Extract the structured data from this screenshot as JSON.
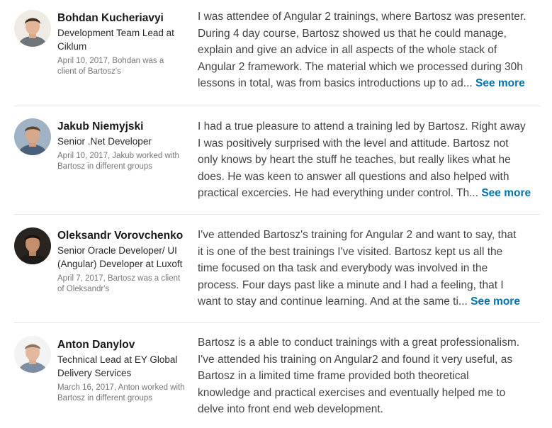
{
  "colors": {
    "link": "#0073b1",
    "divider": "#e6e6e6"
  },
  "recommendations": [
    {
      "name": "Bohdan Kucheriavyi",
      "headline": "Development Team Lead at Ciklum",
      "meta": "April 10, 2017, Bohdan was a client of Bartosz's",
      "text_lines": [
        "I was attendee of Angular 2 trainings, where Bartosz was presenter.",
        "During 4 day course, Bartosz showed us that he could manage,",
        "explain and give an advice in all aspects of the whole stack of",
        "Angular 2 framework. The material which we processed during 30h",
        "lessons in total, was from basics introductions up to ad..."
      ],
      "see_more": "See more"
    },
    {
      "name": "Jakub Niemyjski",
      "headline": "Senior .Net Developer",
      "meta": "April 10, 2017, Jakub worked with Bartosz in different groups",
      "text_lines": [
        "I had a true pleasure to attend a training led by Bartosz. Right away",
        "I was positively surprised with the level and attitude. Bartosz not",
        "only knows by heart the stuff he teaches, but really likes what he",
        "does. He was keen to answer all questions and also helped with",
        "practical excercies. He had everything under control. Th..."
      ],
      "see_more": "See more"
    },
    {
      "name": "Oleksandr Vorovchenko",
      "headline": "Senior Oracle Developer/ UI (Angular) Developer at Luxoft",
      "meta": "April 7, 2017, Bartosz was a client of Oleksandr's",
      "text_lines": [
        "I've attended Bartosz's training for Angular 2 and want to say, that",
        "it is one of the best trainings I've visited. Bartosz kept us all the",
        "time focused on tha task and everybody was involved in the",
        "process. Four days past like a minute and I had a feeling, that I",
        "want to stay and continue learning. And at the same ti..."
      ],
      "see_more": "See more"
    },
    {
      "name": "Anton Danylov",
      "headline": "Technical Lead at EY Global Delivery Services",
      "meta": "March 16, 2017, Anton worked with Bartosz in different groups",
      "text_lines": [
        "Bartosz is a able to conduct trainings with a great professionalism.",
        "I've attended his training on Angular2 and found it very useful, as",
        "Bartosz in a limited time frame provided both theoretical",
        "knowledge and practical exercises and eventually helped me to",
        "delve into front end web development."
      ]
    }
  ]
}
